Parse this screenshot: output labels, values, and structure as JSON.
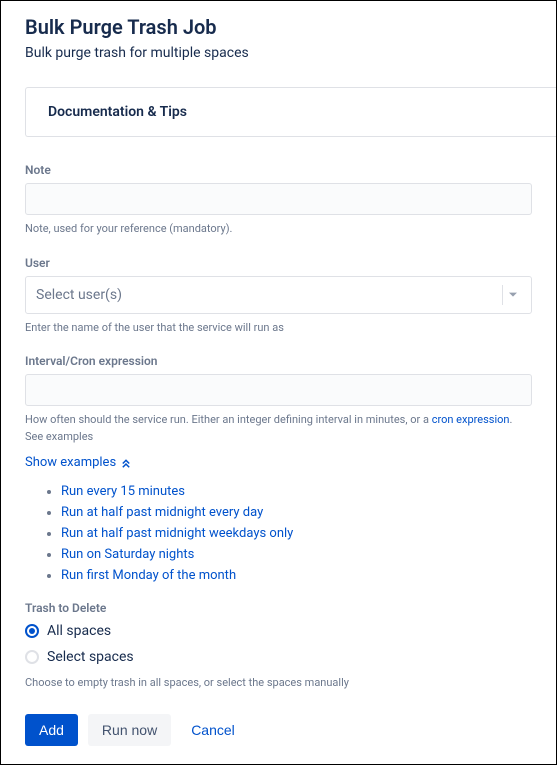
{
  "header": {
    "title": "Bulk Purge Trash Job",
    "subtitle": "Bulk purge trash for multiple spaces"
  },
  "doc_panel": {
    "title": "Documentation & Tips"
  },
  "fields": {
    "note": {
      "label": "Note",
      "value": "",
      "help": "Note, used for your reference (mandatory)."
    },
    "user": {
      "label": "User",
      "placeholder": "Select user(s)",
      "help": "Enter the name of the user that the service will run as"
    },
    "interval": {
      "label": "Interval/Cron expression",
      "value": "",
      "help_prefix": "How often should the service run. Either an integer defining interval in minutes, or a ",
      "help_link_text": "cron expression",
      "help_suffix": ". See examples",
      "show_examples_label": "Show examples",
      "examples": [
        "Run every 15 minutes",
        "Run at half past midnight every day",
        "Run at half past midnight weekdays only",
        "Run on Saturday nights",
        "Run first Monday of the month"
      ]
    },
    "trash": {
      "label": "Trash to Delete",
      "options": [
        {
          "label": "All spaces",
          "checked": true
        },
        {
          "label": "Select spaces",
          "checked": false
        }
      ],
      "help": "Choose to empty trash in all spaces, or select the spaces manually"
    }
  },
  "actions": {
    "add": "Add",
    "run_now": "Run now",
    "cancel": "Cancel"
  }
}
